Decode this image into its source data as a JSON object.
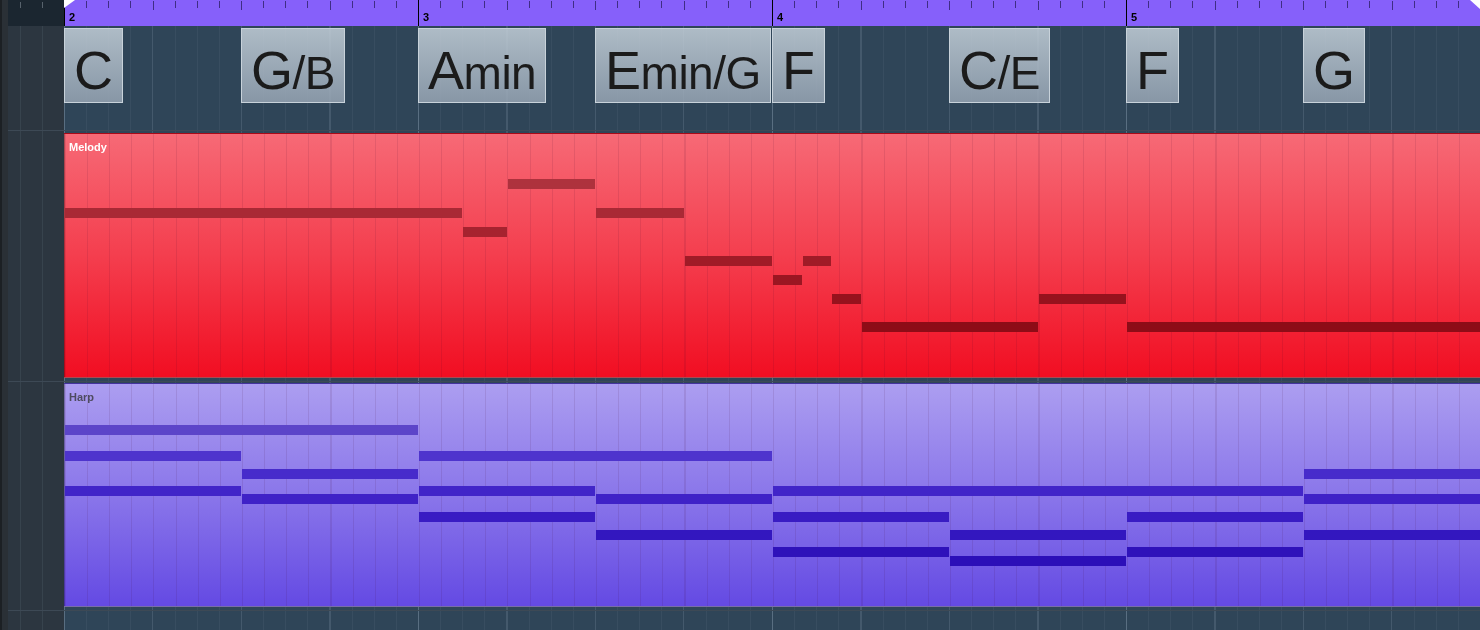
{
  "ruler": {
    "bars": [
      "2",
      "3",
      "4",
      "5"
    ]
  },
  "chord_track": {
    "chords": [
      {
        "root": "C"
      },
      {
        "root": "G",
        "suffix": "/B"
      },
      {
        "root": "A",
        "suffix": "min"
      },
      {
        "root": "E",
        "suffix": "min/G"
      },
      {
        "root": "F"
      },
      {
        "root": "C",
        "suffix": "/E"
      },
      {
        "root": "F"
      },
      {
        "root": "G"
      }
    ]
  },
  "tracks": [
    {
      "name": "Melody",
      "color": "#f43e4e"
    },
    {
      "name": "Harp",
      "color": "#8a76ea"
    }
  ]
}
